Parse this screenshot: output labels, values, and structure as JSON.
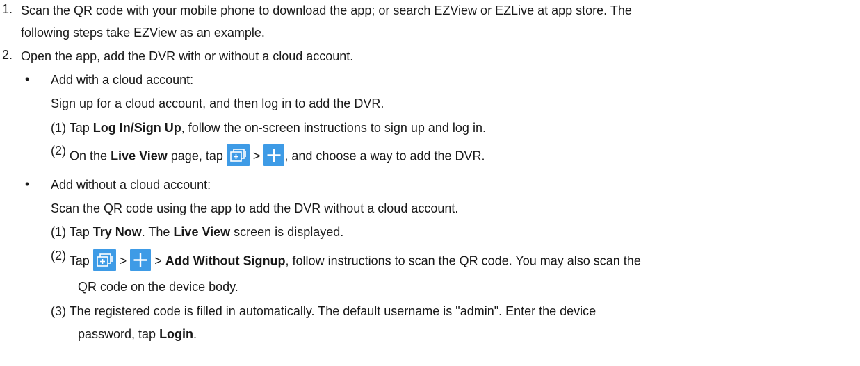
{
  "step1": {
    "num": "1.",
    "line1": "Scan the QR code with your mobile phone to download the app; or search EZView or EZLive at app store. The",
    "line2": "following steps take EZView as an example."
  },
  "step2": {
    "num": "2.",
    "text": "Open the app, add the DVR with or without a cloud account."
  },
  "with_cloud": {
    "bullet": "•",
    "heading": "Add with a cloud account:",
    "intro": "Sign up for a cloud account, and then log in to add the DVR.",
    "s1_num": "(1)",
    "s1_pre": "Tap ",
    "s1_bold": "Log In/Sign Up",
    "s1_post": ", follow the on-screen instructions to sign up and log in.",
    "s2_num": "(2)",
    "s2_pre": "On the ",
    "s2_bold": "Live View",
    "s2_mid": " page, tap ",
    "s2_sep": " > ",
    "s2_post": ", and choose a way to add the DVR."
  },
  "without_cloud": {
    "bullet": "•",
    "heading": "Add without a cloud account:",
    "intro": "Scan the QR code using the app to add the DVR without a cloud account.",
    "s1_num": "(1)",
    "s1_pre": "Tap ",
    "s1_bold1": "Try Now",
    "s1_mid": ". The ",
    "s1_bold2": "Live View",
    "s1_post": " screen is displayed.",
    "s2_num": "(2)",
    "s2_pre": "Tap ",
    "s2_sep1": " > ",
    "s2_sep2": " > ",
    "s2_bold": "Add Without Signup",
    "s2_post": ", follow instructions to scan the QR code. You may also scan the",
    "s2_line2": "QR code on the device body.",
    "s3_num": "(3)",
    "s3_line1": "The registered code is filled in automatically. The default username is \"admin\". Enter the device",
    "s3_pre2": "password, tap ",
    "s3_bold": "Login",
    "s3_post2": "."
  },
  "icons": {
    "device": "add-device-icon",
    "plus": "plus-icon",
    "color": "#3e9be6"
  }
}
